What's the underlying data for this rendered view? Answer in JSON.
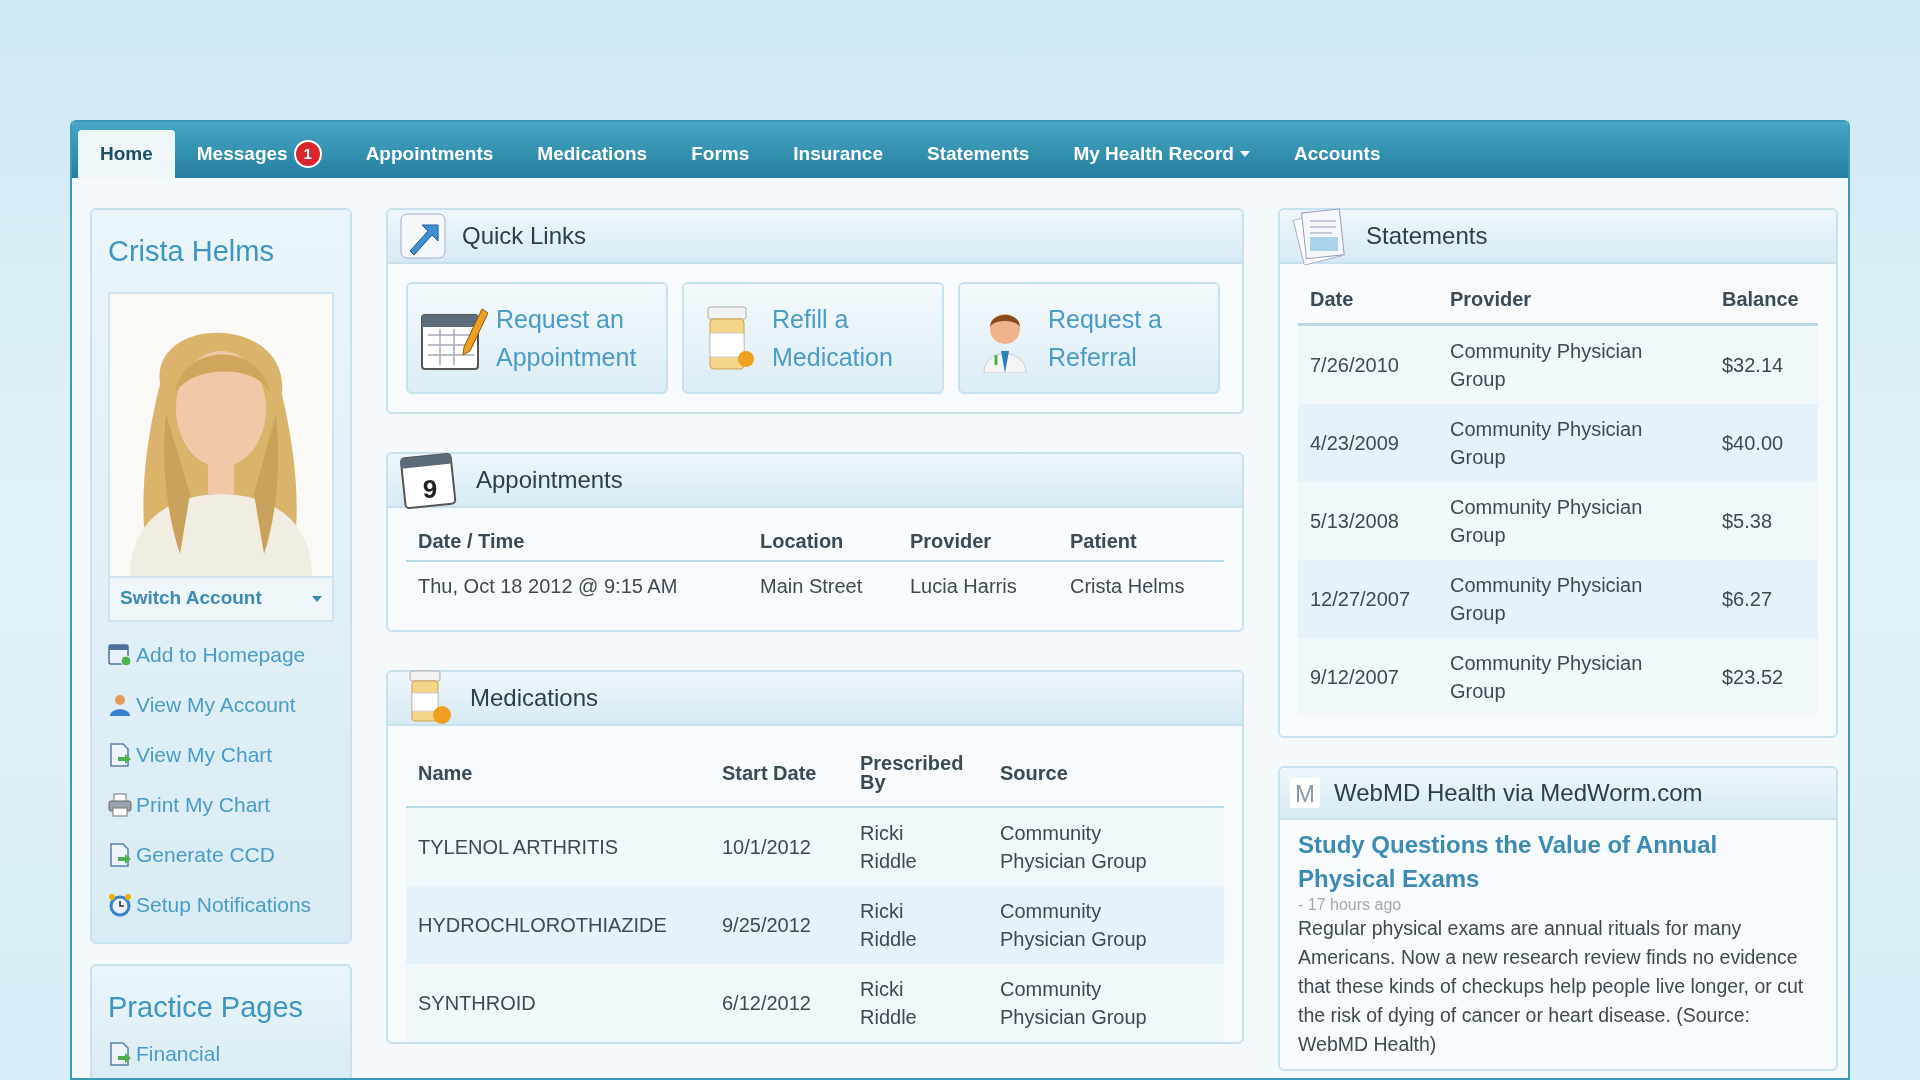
{
  "nav": {
    "tabs": [
      {
        "label": "Home",
        "selected": true,
        "has_menu": false
      },
      {
        "label": "Messages",
        "selected": false,
        "badge": "1",
        "has_menu": false
      },
      {
        "label": "Appointments",
        "selected": false,
        "has_menu": false
      },
      {
        "label": "Medications",
        "selected": false,
        "has_menu": false
      },
      {
        "label": "Forms",
        "selected": false,
        "has_menu": false
      },
      {
        "label": "Insurance",
        "selected": false,
        "has_menu": false
      },
      {
        "label": "Statements",
        "selected": false,
        "has_menu": false
      },
      {
        "label": "My Health Record",
        "selected": false,
        "has_menu": true
      },
      {
        "label": "Accounts",
        "selected": false,
        "has_menu": false
      }
    ]
  },
  "profile": {
    "name": "Crista Helms",
    "switch_account": "Switch Account",
    "links": [
      {
        "label": "Add to Homepage",
        "kind": "homepage"
      },
      {
        "label": "View My Account",
        "kind": "account"
      },
      {
        "label": "View My Chart",
        "kind": "chart"
      },
      {
        "label": "Print My Chart",
        "kind": "print"
      },
      {
        "label": "Generate CCD",
        "kind": "chart"
      },
      {
        "label": "Setup Notifications",
        "kind": "alarm"
      }
    ]
  },
  "practice_pages": {
    "title": "Practice Pages",
    "links": [
      {
        "label": "Financial",
        "kind": "chart"
      }
    ]
  },
  "quick_links": {
    "title": "Quick Links",
    "items": [
      {
        "label": "Request an Appointment",
        "kind": "calendar"
      },
      {
        "label": "Refill a Medication",
        "kind": "bottle"
      },
      {
        "label": "Request a Referral",
        "kind": "doctor"
      }
    ]
  },
  "appointments": {
    "title": "Appointments",
    "icon_text": "9",
    "columns": [
      "Date / Time",
      "Location",
      "Provider",
      "Patient"
    ],
    "rows": [
      [
        "Thu, Oct 18 2012 @ 9:15 AM",
        "Main Street",
        "Lucia Harris",
        "Crista Helms"
      ]
    ]
  },
  "medications": {
    "title": "Medications",
    "columns": [
      "Name",
      "Start Date",
      "Prescribed By",
      "Source"
    ],
    "rows": [
      {
        "name": "TYLENOL ARTHRITIS",
        "start_date": "10/1/2012",
        "prescribed_by": "Ricki Riddle",
        "source": "Community Physician Group"
      },
      {
        "name": "HYDROCHLOROTHIAZIDE",
        "start_date": "9/25/2012",
        "prescribed_by": "Ricki Riddle",
        "source": "Community Physician Group"
      },
      {
        "name": "SYNTHROID",
        "start_date": "6/12/2012",
        "prescribed_by": "Ricki Riddle",
        "source": "Community Physician Group"
      }
    ]
  },
  "statements": {
    "title": "Statements",
    "columns": [
      "Date",
      "Provider",
      "Balance"
    ],
    "rows": [
      [
        "7/26/2010",
        "Community Physician Group",
        "$32.14"
      ],
      [
        "4/23/2009",
        "Community Physician Group",
        "$40.00"
      ],
      [
        "5/13/2008",
        "Community Physician Group",
        "$5.38"
      ],
      [
        "12/27/2007",
        "Community Physician Group",
        "$6.27"
      ],
      [
        "9/12/2007",
        "Community Physician Group",
        "$23.52"
      ]
    ]
  },
  "news": {
    "title": "WebMD Health via MedWorm.com",
    "icon_text": "M",
    "headline": "Study Questions the Value of Annual Physical Exams",
    "age": "- 17 hours ago",
    "body": "Regular physical exams are annual rituals for many Americans. Now a new research review finds no evidence that these kinds of checkups help people live longer, or cut the risk of dying of cancer or heart disease. (Source: WebMD Health)"
  }
}
